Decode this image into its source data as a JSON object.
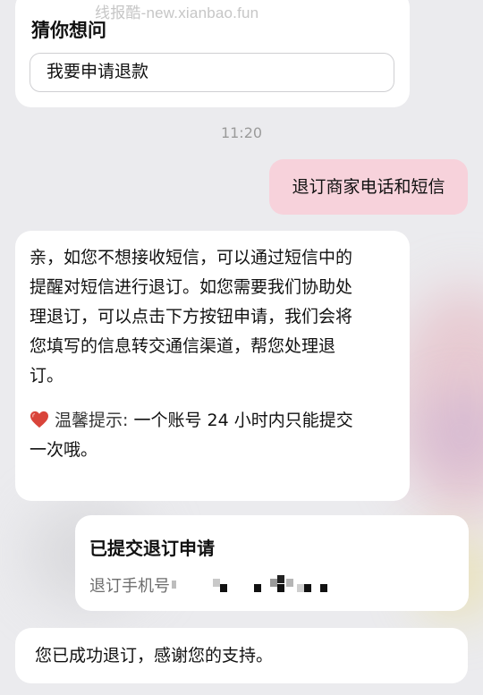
{
  "watermark": "线报酷-new.xianbao.fun",
  "guess": {
    "title": "猜你想问",
    "chip": "我要申请退款"
  },
  "timestamp": "11:20",
  "user_message": "退订商家电话和短信",
  "reply": {
    "lines": [
      "亲，如您不想接收短信，可以通过短信中的",
      "提醒对短信进行退订。如您需要我们协助处",
      "理退订，可以点击下方按钮申请，我们会将",
      "您填写的信息转交通信渠道，帮您处理退",
      "订。"
    ],
    "tip_label": "温馨提示:",
    "tip_text_line1": " 一个账号 24 小时内只能提交",
    "tip_text_line2": "一次哦。"
  },
  "submitted": {
    "title": "已提交退订申请",
    "phone_label": "退订手机号"
  },
  "final_message": "您已成功退订，感谢您的支持。",
  "colors": {
    "user_bubble": "#f7d2db",
    "card_bg": "#ffffff",
    "page_bg": "#ebebee",
    "heart": "#d9443a"
  },
  "icons": {
    "heart": "heart-icon"
  }
}
